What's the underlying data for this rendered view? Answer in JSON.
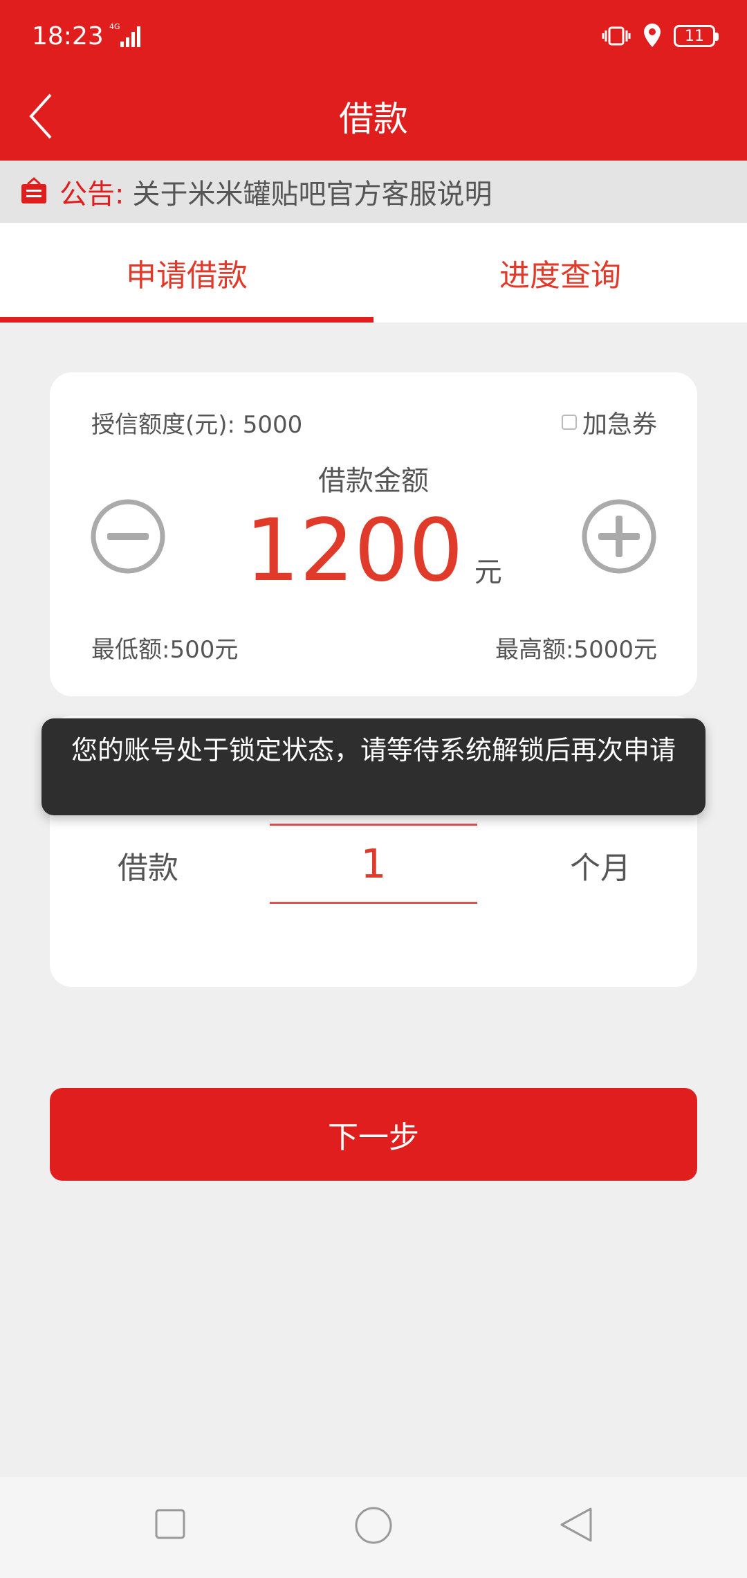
{
  "status_bar": {
    "time": "18:23",
    "network": "4G",
    "battery": "11"
  },
  "header": {
    "title": "借款"
  },
  "notice": {
    "label": "公告:",
    "text": "关于米米罐贴吧官方客服说明"
  },
  "tabs": [
    {
      "label": "申请借款",
      "active": true
    },
    {
      "label": "进度查询",
      "active": false
    }
  ],
  "loan_card": {
    "credit_label": "授信额度(元): 5000",
    "urgent_label": "加急券",
    "amount_label": "借款金额",
    "amount_value": "1200",
    "amount_unit": "元",
    "min_amount": "最低额:500元",
    "max_amount": "最高额:5000元"
  },
  "term_card": {
    "label": "借款",
    "value": "1",
    "unit": "个月"
  },
  "toast": {
    "message": "您的账号处于锁定状态，请等待系统解锁后再次申请"
  },
  "next_button": {
    "label": "下一步"
  },
  "colors": {
    "primary": "#e01e1e",
    "accent_text": "#e03a2a",
    "background": "#efefef"
  }
}
